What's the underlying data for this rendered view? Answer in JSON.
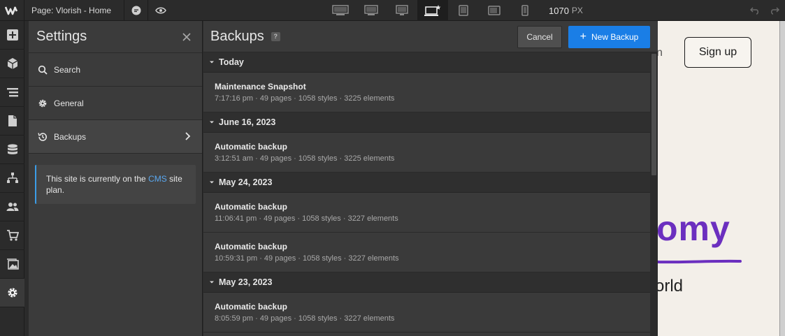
{
  "topbar": {
    "page_label": "Page: Vlorish - Home",
    "canvas_width": "1070",
    "canvas_unit": "PX"
  },
  "settings": {
    "title": "Settings",
    "nav": [
      {
        "label": "Search"
      },
      {
        "label": "General"
      },
      {
        "label": "Backups"
      }
    ],
    "plan_text_before": "This site is currently on the ",
    "plan_link": "CMS",
    "plan_text_after": " site plan."
  },
  "backups": {
    "title": "Backups",
    "help": "?",
    "cancel_label": "Cancel",
    "new_label": "New Backup",
    "groups": [
      {
        "date": "Today",
        "items": [
          {
            "title": "Maintenance Snapshot",
            "meta": "7:17:16 pm · 49 pages · 1058 styles · 3225 elements"
          }
        ]
      },
      {
        "date": "June 16, 2023",
        "items": [
          {
            "title": "Automatic backup",
            "meta": "3:12:51 am · 49 pages · 1058 styles · 3225 elements"
          }
        ]
      },
      {
        "date": "May 24, 2023",
        "items": [
          {
            "title": "Automatic backup",
            "meta": "11:06:41 pm · 49 pages · 1058 styles · 3227 elements"
          },
          {
            "title": "Automatic backup",
            "meta": "10:59:31 pm · 49 pages · 1058 styles · 3227 elements"
          }
        ]
      },
      {
        "date": "May 23, 2023",
        "items": [
          {
            "title": "Automatic backup",
            "meta": "8:05:59 pm · 49 pages · 1058 styles · 3227 elements"
          }
        ]
      }
    ]
  },
  "canvas": {
    "nav_partial": "n",
    "signup_label": "Sign up",
    "hero_word": "omy",
    "hero_sub": "orld"
  },
  "colors": {
    "accent_blue": "#1a7ee6",
    "link_blue": "#5aa8f0",
    "hero_purple": "#6b2fbf"
  },
  "icons": {
    "rail": [
      "add-icon",
      "box-icon",
      "navigator-icon",
      "pages-icon",
      "cms-icon",
      "logic-icon",
      "users-icon",
      "ecommerce-icon",
      "assets-icon",
      "settings-gear-icon"
    ]
  }
}
